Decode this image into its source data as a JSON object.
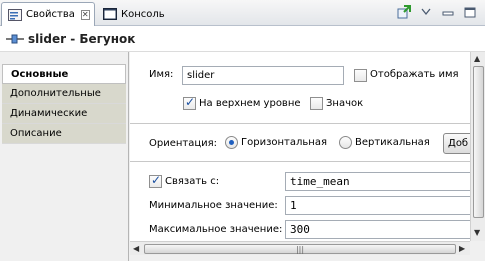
{
  "tabs": [
    {
      "label": "Свойства",
      "close": "✕"
    },
    {
      "label": "Консоль"
    }
  ],
  "header": {
    "title": "slider - Бегунок"
  },
  "nav": {
    "items": [
      {
        "label": "Основные"
      },
      {
        "label": "Дополнительные"
      },
      {
        "label": "Динамические"
      },
      {
        "label": "Описание"
      }
    ]
  },
  "main": {
    "name_label": "Имя:",
    "name_value": "slider",
    "show_name_label": "Отображать имя",
    "top_level_label": "На верхнем уровне",
    "icon_label": "Значок",
    "orientation_label": "Ориентация:",
    "horizontal_label": "Горизонтальная",
    "vertical_label": "Вертикальная",
    "add_button_label": "Доб",
    "link_label": "Связать с:",
    "link_value": "time_mean",
    "min_label": "Минимальное значение:",
    "min_value": "1",
    "max_label": "Максимальное значение:",
    "max_value": "300"
  },
  "icons": {
    "properties_tab": "properties-icon",
    "console_tab": "console-icon",
    "pin": "pin-icon",
    "view_menu": "chevron-down-icon",
    "minimize": "minimize-icon",
    "maximize": "maximize-icon"
  },
  "colors": {
    "accent": "#1f5fbf",
    "nav_bg": "#d8d8cc"
  }
}
